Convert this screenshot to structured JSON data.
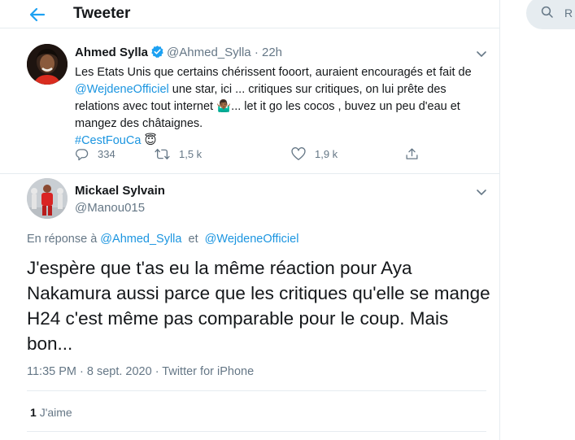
{
  "header": {
    "title": "Tweeter"
  },
  "search": {
    "placeholder": "R"
  },
  "original_tweet": {
    "name": "Ahmed Sylla",
    "handle": "@Ahmed_Sylla",
    "separator": "·",
    "time": "22h",
    "text_part1": "Les Etats Unis que certains chérissent fooort, auraient encouragés et fait de ",
    "mention": "@WejdeneOfficiel",
    "text_part2": " une star, ici ... critiques sur critiques, on lui prête des relations avec tout internet ",
    "emoji1": "🤷🏾‍♂️",
    "text_part3": "... let it go les cocos , buvez un peu d'eau et mangez des châtaignes.",
    "hashtag": "#CestFouCa",
    "emoji2": "😇",
    "replies": "334",
    "retweets": "1,5 k",
    "likes": "1,9 k",
    "icons": [
      "reply-icon",
      "retweet-icon",
      "like-icon",
      "share-icon",
      "verified-icon",
      "caret-down-icon"
    ]
  },
  "reply_tweet": {
    "name": "Mickael Sylvain",
    "handle": "@Manou015",
    "reply_prefix": "En réponse à",
    "reply_mention1": "@Ahmed_Sylla",
    "reply_and": "et",
    "reply_mention2": "@WejdeneOfficiel",
    "text": "J'espère que t'as eu la même réaction pour Aya Nakamura aussi parce que les critiques qu'elle se mange H24 c'est même pas comparable pour le coup. Mais bon...",
    "meta": "11:35 PM · 8 sept. 2020 · Twitter for iPhone",
    "likes_count": "1",
    "likes_label": "J'aime"
  },
  "colors": {
    "accent": "#1da1f2",
    "link": "#1b95e0",
    "muted": "#657786",
    "border": "#e6ecf0"
  }
}
